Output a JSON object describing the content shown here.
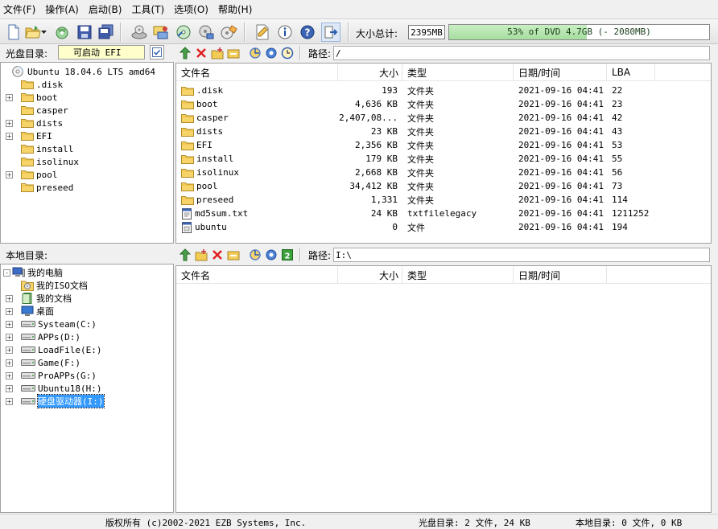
{
  "menu": [
    "文件(F)",
    "操作(A)",
    "启动(B)",
    "工具(T)",
    "选项(O)",
    "帮助(H)"
  ],
  "toolbar": {
    "buttons": [
      "new-icon",
      "open-icon",
      "dropdown-arrow-icon",
      "extract-icon",
      "save-icon",
      "save-as-icon",
      "burn-icon",
      "mount-icon",
      "compress-icon",
      "virtual-drive-icon",
      "burn-cd-icon",
      "properties-icon",
      "info-icon",
      "help-icon",
      "exit-icon"
    ],
    "size_label": "大小总计:",
    "size_value": "2395MB",
    "capacity_text": "53% of DVD 4.7GB (- 2080MB)",
    "capacity_percent": 53
  },
  "disc": {
    "label": "光盘目录:",
    "boot_label": "可启动 EFI",
    "path_label": "路径:",
    "path_value": "/",
    "tree": [
      {
        "label": "Ubuntu 18.04.6 LTS amd64",
        "expander": "none",
        "level": 0,
        "icon": "cd-icon"
      },
      {
        "label": ".disk",
        "expander": "none",
        "level": 1,
        "icon": "folder-icon"
      },
      {
        "label": "boot",
        "expander": "+",
        "level": 1,
        "icon": "folder-icon"
      },
      {
        "label": "casper",
        "expander": "none",
        "level": 1,
        "icon": "folder-icon"
      },
      {
        "label": "dists",
        "expander": "+",
        "level": 1,
        "icon": "folder-icon"
      },
      {
        "label": "EFI",
        "expander": "+",
        "level": 1,
        "icon": "folder-icon"
      },
      {
        "label": "install",
        "expander": "none",
        "level": 1,
        "icon": "folder-icon"
      },
      {
        "label": "isolinux",
        "expander": "none",
        "level": 1,
        "icon": "folder-icon"
      },
      {
        "label": "pool",
        "expander": "+",
        "level": 1,
        "icon": "folder-icon"
      },
      {
        "label": "preseed",
        "expander": "none",
        "level": 1,
        "icon": "folder-icon"
      }
    ],
    "columns": [
      "文件名",
      "大小",
      "类型",
      "日期/时间",
      "LBA"
    ],
    "files": [
      {
        "name": ".disk",
        "size": "193",
        "type": "文件夹",
        "date": "2021-09-16 04:41",
        "lba": "22",
        "icon": "folder-icon"
      },
      {
        "name": "boot",
        "size": "4,636 KB",
        "type": "文件夹",
        "date": "2021-09-16 04:41",
        "lba": "23",
        "icon": "folder-icon"
      },
      {
        "name": "casper",
        "size": "2,407,08...",
        "type": "文件夹",
        "date": "2021-09-16 04:41",
        "lba": "42",
        "icon": "folder-icon"
      },
      {
        "name": "dists",
        "size": "23 KB",
        "type": "文件夹",
        "date": "2021-09-16 04:41",
        "lba": "43",
        "icon": "folder-icon"
      },
      {
        "name": "EFI",
        "size": "2,356 KB",
        "type": "文件夹",
        "date": "2021-09-16 04:41",
        "lba": "53",
        "icon": "folder-icon"
      },
      {
        "name": "install",
        "size": "179 KB",
        "type": "文件夹",
        "date": "2021-09-16 04:41",
        "lba": "55",
        "icon": "folder-icon"
      },
      {
        "name": "isolinux",
        "size": "2,668 KB",
        "type": "文件夹",
        "date": "2021-09-16 04:41",
        "lba": "56",
        "icon": "folder-icon"
      },
      {
        "name": "pool",
        "size": "34,412 KB",
        "type": "文件夹",
        "date": "2021-09-16 04:41",
        "lba": "73",
        "icon": "folder-icon"
      },
      {
        "name": "preseed",
        "size": "1,331",
        "type": "文件夹",
        "date": "2021-09-16 04:41",
        "lba": "114",
        "icon": "folder-icon"
      },
      {
        "name": "md5sum.txt",
        "size": "24 KB",
        "type": "txtfilelegacy",
        "date": "2021-09-16 04:41",
        "lba": "1211252",
        "icon": "text-file-icon"
      },
      {
        "name": "ubuntu",
        "size": "0",
        "type": "文件",
        "date": "2021-09-16 04:41",
        "lba": "194",
        "icon": "file-icon"
      }
    ]
  },
  "local": {
    "label": "本地目录:",
    "path_label": "路径:",
    "path_value": "I:\\",
    "tree": [
      {
        "label": "我的电脑",
        "expander": "-",
        "level": 0,
        "icon": "computer-icon"
      },
      {
        "label": "我的ISO文档",
        "expander": "none",
        "level": 1,
        "icon": "iso-docs-icon"
      },
      {
        "label": "我的文档",
        "expander": "+",
        "level": 1,
        "icon": "documents-icon"
      },
      {
        "label": "桌面",
        "expander": "+",
        "level": 1,
        "icon": "desktop-icon"
      },
      {
        "label": "Systeam(C:)",
        "expander": "+",
        "level": 1,
        "icon": "drive-icon"
      },
      {
        "label": "APPs(D:)",
        "expander": "+",
        "level": 1,
        "icon": "drive-icon"
      },
      {
        "label": "LoadFile(E:)",
        "expander": "+",
        "level": 1,
        "icon": "drive-icon"
      },
      {
        "label": "Game(F:)",
        "expander": "+",
        "level": 1,
        "icon": "drive-icon"
      },
      {
        "label": "ProAPPs(G:)",
        "expander": "+",
        "level": 1,
        "icon": "drive-icon"
      },
      {
        "label": "Ubuntu18(H:)",
        "expander": "+",
        "level": 1,
        "icon": "drive-icon"
      },
      {
        "label": "硬盘驱动器(I:)",
        "expander": "+",
        "level": 1,
        "icon": "drive-icon",
        "selected": true
      }
    ],
    "columns": [
      "文件名",
      "大小",
      "类型",
      "日期/时间"
    ]
  },
  "status": {
    "copyright": "版权所有 (c)2002-2021 EZB Systems, Inc.",
    "disc_summary": "光盘目录: 2 文件, 24 KB",
    "local_summary": "本地目录: 0 文件, 0 KB"
  }
}
